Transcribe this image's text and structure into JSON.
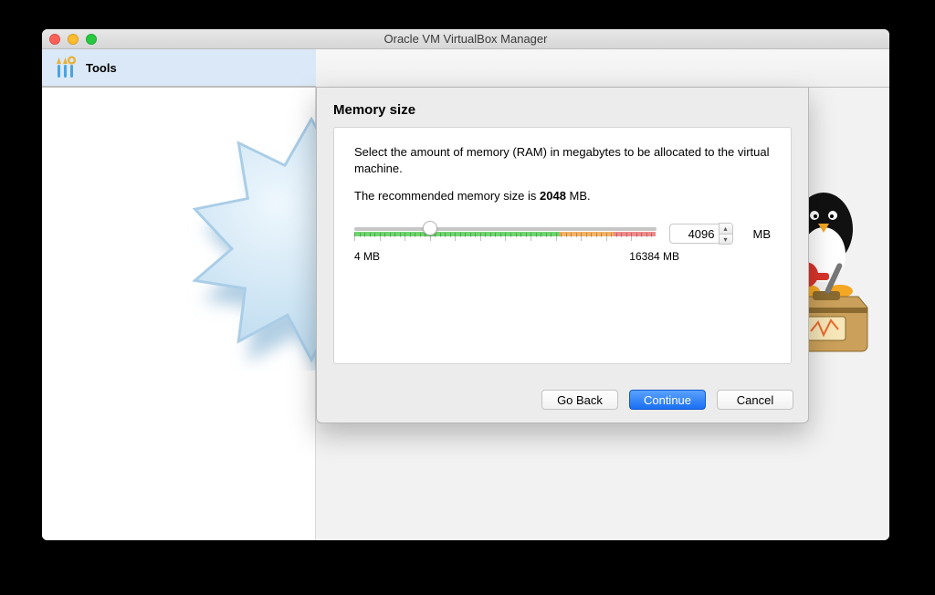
{
  "window": {
    "title": "Oracle VM VirtualBox Manager"
  },
  "sidebar": {
    "tools_label": "Tools"
  },
  "wizard": {
    "title": "Memory size",
    "description": "Select the amount of memory (RAM) in megabytes to be allocated to the virtual machine.",
    "recommended_prefix": "The recommended memory size is ",
    "recommended_value": "2048",
    "recommended_suffix": " MB.",
    "slider": {
      "min": 4,
      "max": 16384,
      "value": 4096,
      "thumb_percent": 25,
      "green_percent": 68,
      "orange_percent": 18,
      "red_percent": 14,
      "min_label": "4 MB",
      "max_label": "16384 MB"
    },
    "unit": "MB",
    "buttons": {
      "back": "Go Back",
      "continue": "Continue",
      "cancel": "Cancel"
    }
  },
  "colors": {
    "sidebar_selected": "#dae8f7",
    "primary_button": "#1a6ff3"
  }
}
